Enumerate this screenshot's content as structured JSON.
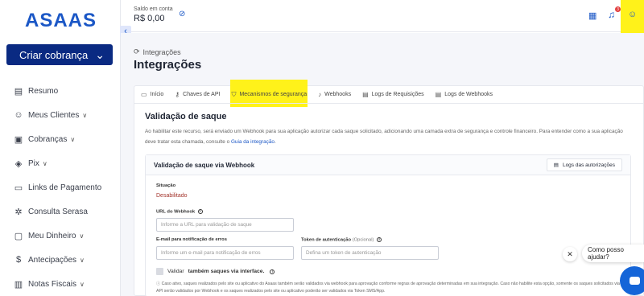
{
  "brand": {
    "logo_text": "ASAAS"
  },
  "sidebar": {
    "create_label": "Criar cobrança",
    "items": [
      {
        "label": "Resumo",
        "icon": "summary-icon",
        "caret": false
      },
      {
        "label": "Meus Clientes",
        "icon": "clients-icon",
        "caret": true
      },
      {
        "label": "Cobranças",
        "icon": "billing-icon",
        "caret": true
      },
      {
        "label": "Pix",
        "icon": "pix-icon",
        "caret": true
      },
      {
        "label": "Links de Pagamento",
        "icon": "payment-link-icon",
        "caret": false
      },
      {
        "label": "Consulta Serasa",
        "icon": "serasa-icon",
        "caret": false
      },
      {
        "label": "Meu Dinheiro",
        "icon": "money-icon",
        "caret": true
      },
      {
        "label": "Antecipações",
        "icon": "advance-icon",
        "caret": true
      },
      {
        "label": "Notas Fiscais",
        "icon": "invoice-icon",
        "caret": true
      }
    ]
  },
  "topbar": {
    "balance_label": "Saldo em conta",
    "balance_value": "R$ 0,00",
    "notification_count": "3",
    "highlight_color": "#fff21a"
  },
  "main": {
    "breadcrumb": "Integrações",
    "title": "Integrações",
    "tabs": [
      {
        "label": "Início",
        "icon": "monitor-icon",
        "active": false
      },
      {
        "label": "Chaves de API",
        "icon": "key-icon",
        "active": false
      },
      {
        "label": "Mecanismos de segurança",
        "icon": "shield-icon",
        "active": true
      },
      {
        "label": "Webhooks",
        "icon": "bell-icon",
        "active": false
      },
      {
        "label": "Logs de Requisições",
        "icon": "list-icon",
        "active": false
      },
      {
        "label": "Logs de Webhooks",
        "icon": "list-icon",
        "active": false
      }
    ],
    "section_title": "Validação de saque",
    "section_desc": "Ao habilitar este recurso, será enviado um Webhook para sua aplicação autorizar cada saque solicitado, adicionando uma camada extra de segurança e controle financeiro. Para entender como a sua aplicação deve tratar esta chamada, consulte o",
    "section_link": "Guia da integração",
    "section_desc_end": ".",
    "panel": {
      "title": "Validação de saque via Webhook",
      "logs_button": "Logs das autorizações",
      "status_label": "Situação",
      "status_value": "Desabilitado",
      "url_label": "URL do Webhook",
      "url_placeholder": "Informe a URL para validação de saque",
      "email_label": "E-mail para notificação de erros",
      "email_placeholder": "Informe um e-mail para notificação de erros",
      "token_label": "Token de autenticação",
      "token_optional": "(Opcional)",
      "token_placeholder": "Defina um token de autenticação",
      "checkbox_label_pre": "Validar",
      "checkbox_label_bold": "também saques via interface.",
      "note": "Caso ativo, saques realizados pelo site ou aplicativo do Asaas também serão validados via webhook para aprovação conforme regras de aprovação determinadas em sua integração. Caso não habilite esta opção, somente os saques solicitados via API serão validados por Webhook e os saques realizados pelo site ou aplicativo poderão ser validados via Token SMS/App."
    }
  },
  "chat": {
    "prompt": "Como posso ajudar?"
  }
}
